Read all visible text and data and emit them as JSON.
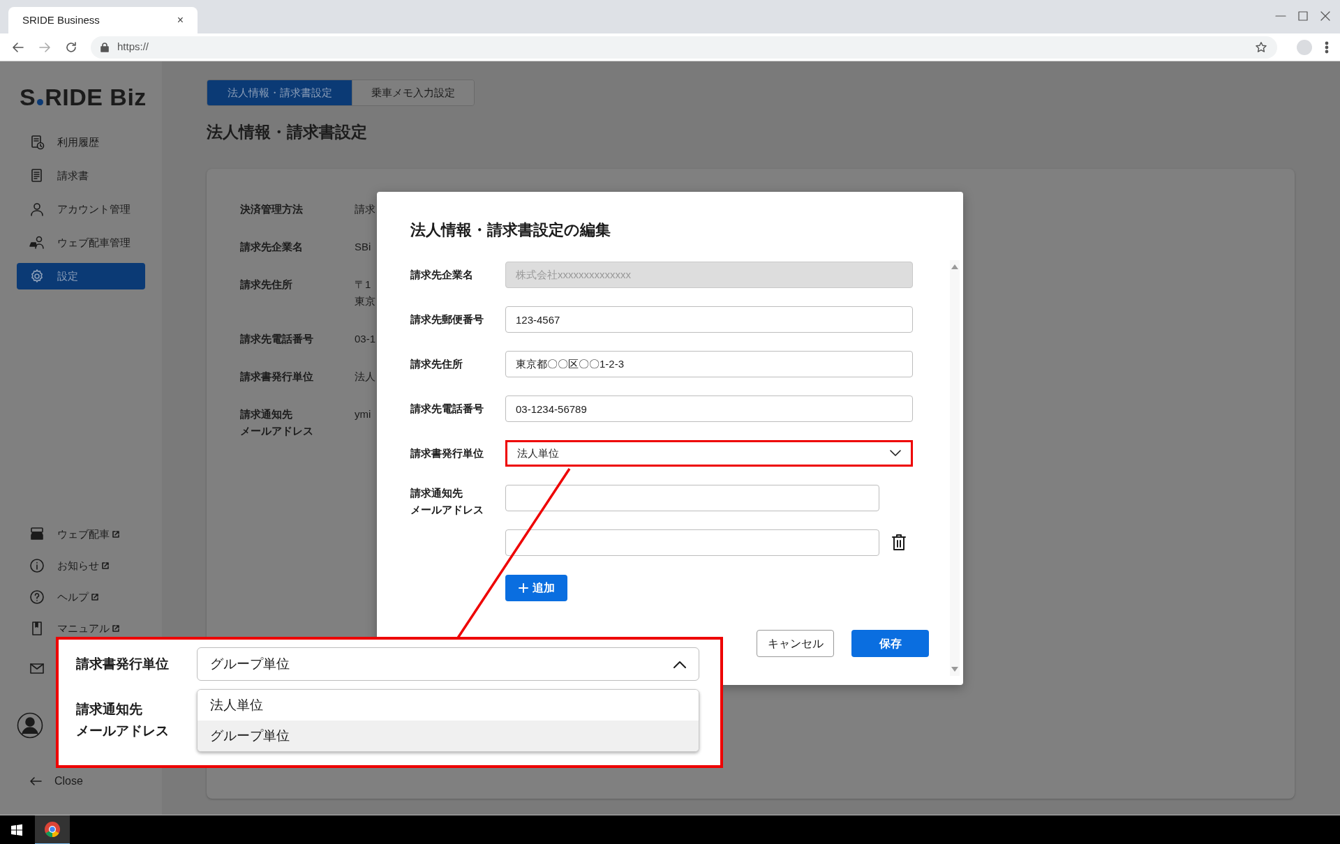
{
  "browser": {
    "tab_title": "SRIDE Business",
    "tab_close": "×",
    "url": "https://"
  },
  "sidebar": {
    "logo_left": "S",
    "logo_right": "RIDE Biz",
    "items": [
      {
        "label": "利用履歴",
        "selected": false
      },
      {
        "label": "請求書",
        "selected": false
      },
      {
        "label": "アカウント管理",
        "selected": false
      },
      {
        "label": "ウェブ配車管理",
        "selected": false
      },
      {
        "label": "設定",
        "selected": true
      }
    ],
    "links": [
      {
        "label": "ウェブ配車",
        "external": true
      },
      {
        "label": "お知らせ",
        "external": true
      },
      {
        "label": "ヘルプ",
        "external": true
      },
      {
        "label": "マニュアル",
        "external": true
      }
    ],
    "close": "Close"
  },
  "tabs": [
    {
      "label": "法人情報・請求書設定",
      "selected": true
    },
    {
      "label": "乗車メモ入力設定",
      "selected": false
    }
  ],
  "page_title": "法人情報・請求書設定",
  "details": [
    {
      "label": "決済管理方法",
      "value": "請求"
    },
    {
      "label": "請求先企業名",
      "value": "SBi"
    },
    {
      "label": "請求先住所",
      "value": "〒1\n東京"
    },
    {
      "label": "請求先電話番号",
      "value": "03-1"
    },
    {
      "label": "請求書発行単位",
      "value": "法人"
    },
    {
      "label": [
        "請求通知先",
        "メールアドレス"
      ],
      "value": "ymi"
    }
  ],
  "dialog": {
    "title": "法人情報・請求書設定の編集",
    "fields": [
      {
        "kind": "input",
        "label": "請求先企業名",
        "value": "株式会社xxxxxxxxxxxxxx",
        "disabled": true
      },
      {
        "kind": "input",
        "label": "請求先郵便番号",
        "value": "123-4567",
        "disabled": false
      },
      {
        "kind": "input",
        "label": "請求先住所",
        "value": "東京都〇〇区〇〇1-2-3",
        "disabled": false
      },
      {
        "kind": "input",
        "label": "請求先電話番号",
        "value": "03-1234-56789",
        "disabled": false
      },
      {
        "kind": "select",
        "label": "請求書発行単位",
        "value": "法人単位",
        "highlighted": true,
        "expanded": false
      },
      {
        "kind": "emails",
        "label": [
          "請求通知先",
          "メールアドレス"
        ],
        "inputs": [
          {
            "deletable": false
          },
          {
            "deletable": true
          }
        ],
        "add_button": "追加"
      }
    ],
    "cancel": "キャンセル",
    "save": "保存"
  },
  "callout": {
    "label": "請求書発行単位",
    "value": "グループ単位",
    "expanded": true,
    "options": [
      {
        "label": "法人単位",
        "selected": false
      },
      {
        "label": "グループ単位",
        "selected": true
      }
    ],
    "label_2": [
      "請求通知先",
      "メールアドレス"
    ]
  }
}
